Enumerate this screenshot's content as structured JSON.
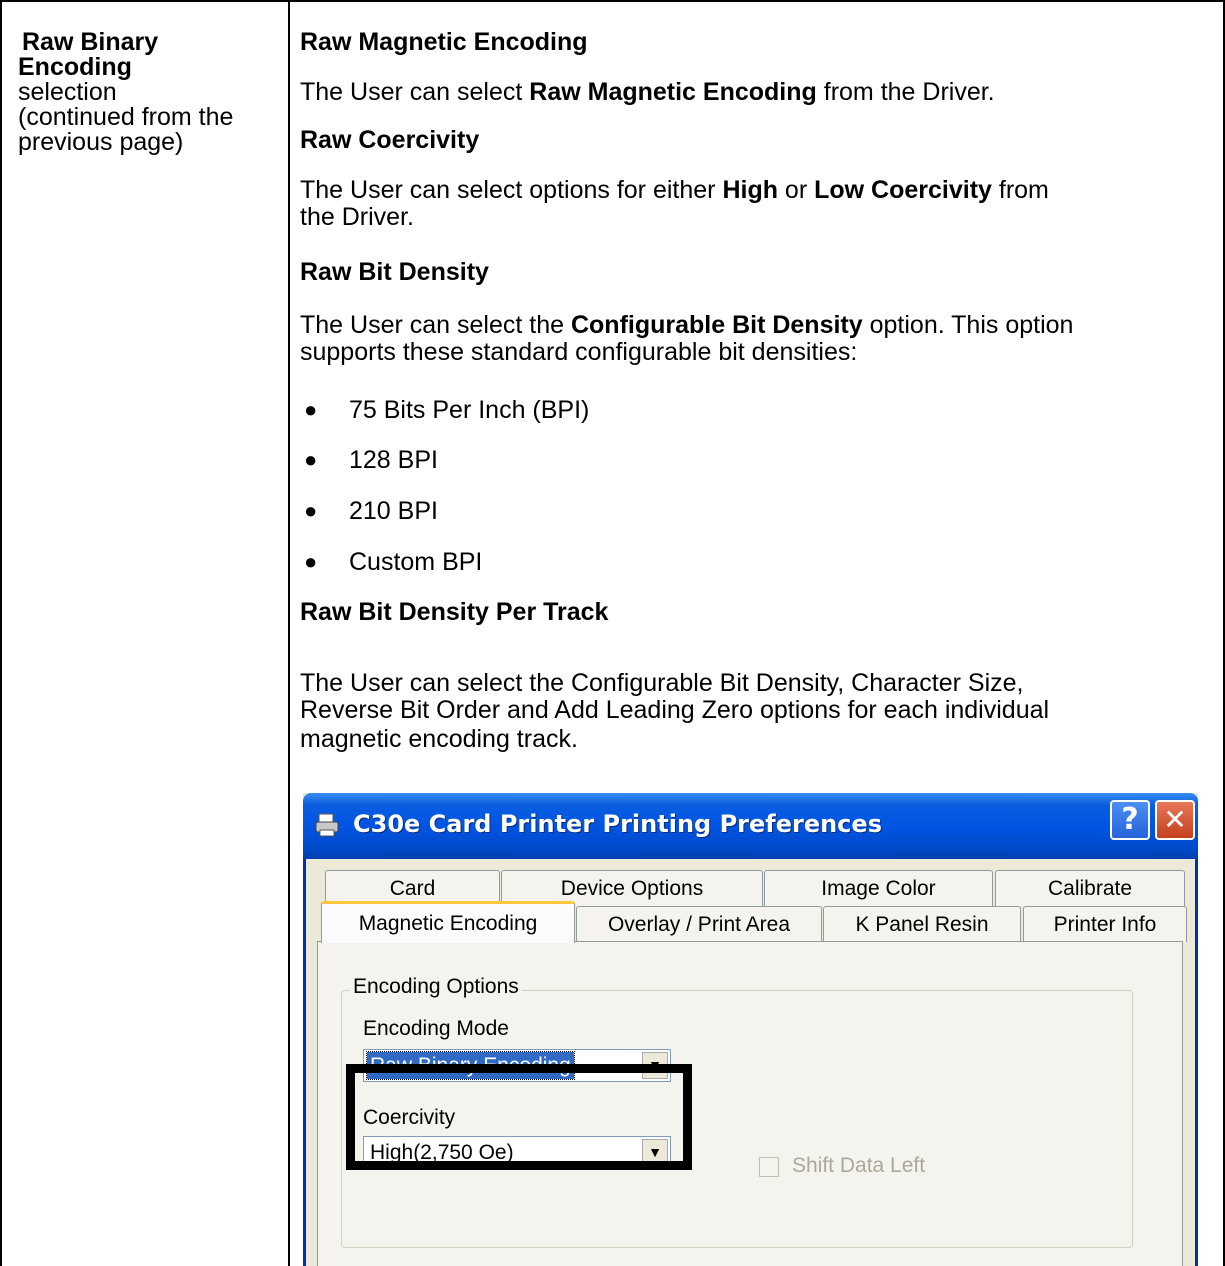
{
  "left_column": {
    "heading_line1": "Raw Binary",
    "heading_line2": "Encoding",
    "text_line1": "selection",
    "text_line2": "(continued from the",
    "text_line3": "previous page)"
  },
  "right_column": {
    "sec1_heading": "Raw Magnetic Encoding",
    "sec1_text_a": "The User can select ",
    "sec1_text_b": "Raw Magnetic Encoding",
    "sec1_text_c": " from the Driver.",
    "sec2_heading": "Raw Coercivity",
    "sec2_line1_a": "The User can select options for either ",
    "sec2_line1_b": "High",
    "sec2_line1_c": " or ",
    "sec2_line1_d": "Low Coercivity",
    "sec2_line1_e": " from",
    "sec2_line2": "the Driver.",
    "sec3_heading": "Raw Bit Density",
    "sec3_line1_a": "The User can select the ",
    "sec3_line1_b": "Configurable Bit Density",
    "sec3_line1_c": " option. This option",
    "sec3_line2": "supports these standard configurable bit densities:",
    "bullets": [
      "75 Bits Per Inch (BPI)",
      "128 BPI",
      "210 BPI",
      "Custom BPI"
    ],
    "sec4_heading": "Raw Bit Density Per Track",
    "sec4_line1": "The User can select the Configurable Bit Density, Character Size,",
    "sec4_line2": "Reverse Bit Order and Add Leading Zero options for each individual",
    "sec4_line3": "magnetic encoding track."
  },
  "dialog": {
    "title": "C30e Card Printer Printing Preferences",
    "help_label": "?",
    "close_label": "✕",
    "tabs_row1": [
      "Card",
      "Device Options",
      "Image Color",
      "Calibrate"
    ],
    "tabs_row2": [
      "Magnetic Encoding",
      "Overlay / Print Area",
      "K Panel Resin",
      "Printer Info"
    ],
    "group_label": "Encoding Options",
    "encoding_mode_label": "Encoding Mode",
    "encoding_mode_value": "Raw Binary Encoding",
    "coercivity_label": "Coercivity",
    "coercivity_value": "High(2,750 Oe)",
    "shift_data_left_label": "Shift Data Left",
    "dropdown_arrow": "▼"
  }
}
